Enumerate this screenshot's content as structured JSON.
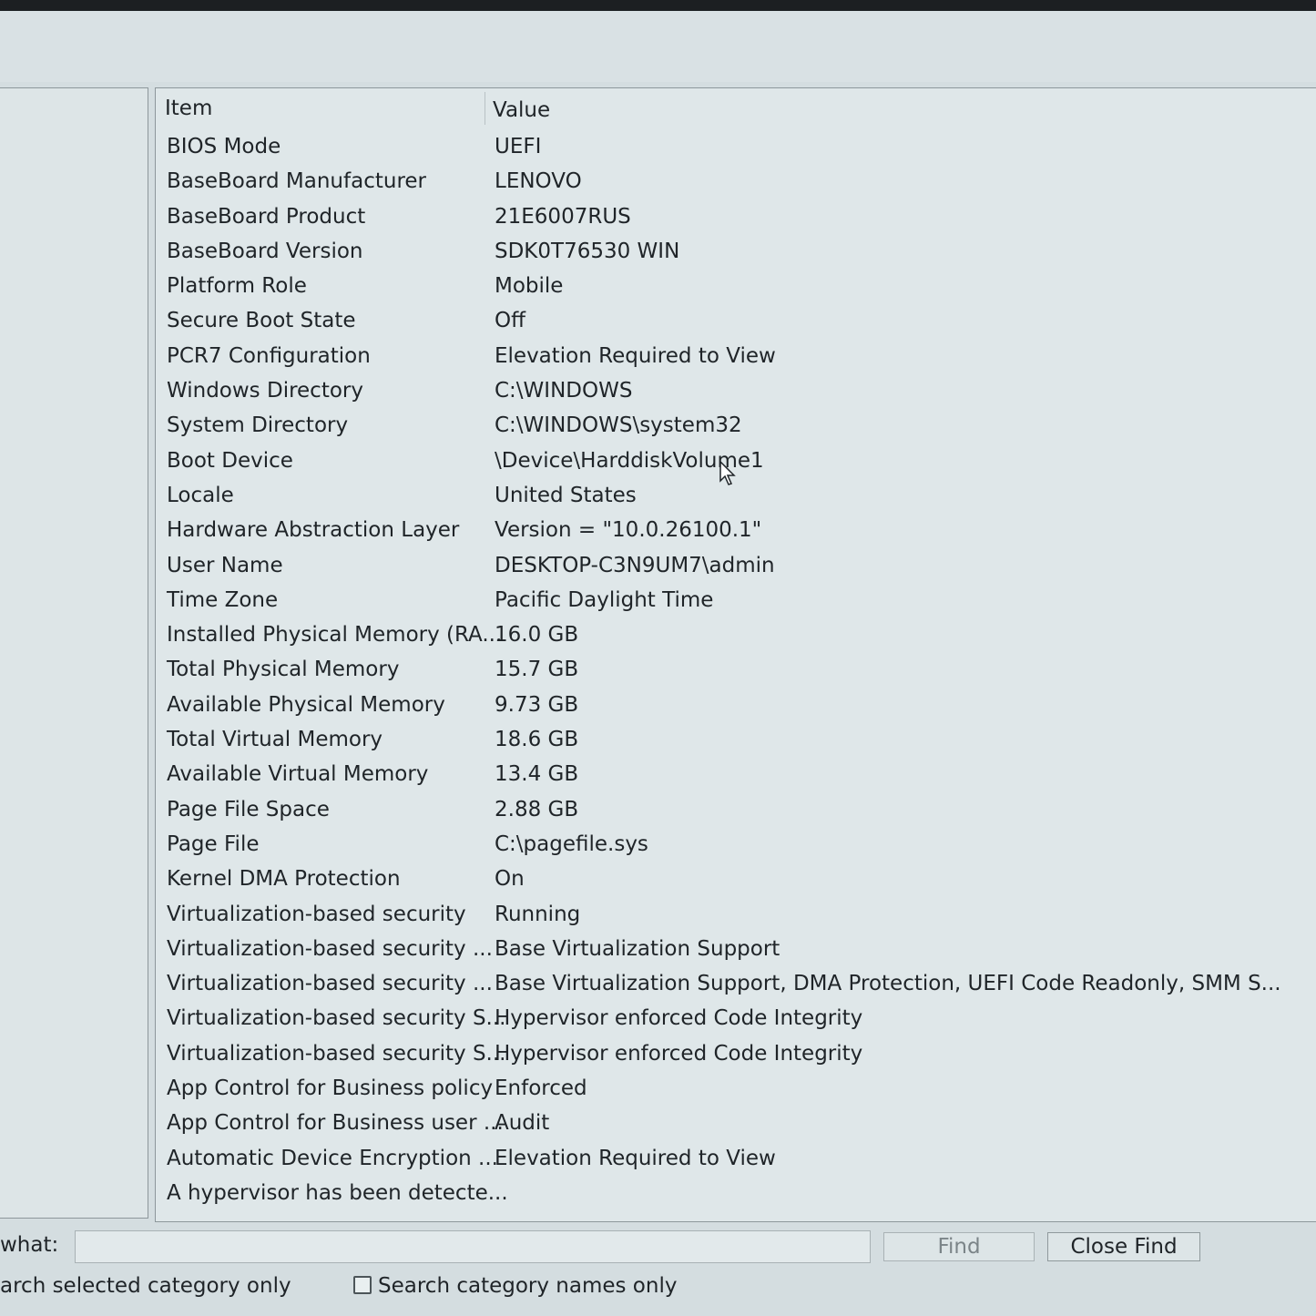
{
  "table": {
    "header": {
      "item": "Item",
      "value": "Value"
    },
    "rows": [
      {
        "item": "BIOS Mode",
        "value": "UEFI"
      },
      {
        "item": "BaseBoard Manufacturer",
        "value": "LENOVO"
      },
      {
        "item": "BaseBoard Product",
        "value": "21E6007RUS"
      },
      {
        "item": "BaseBoard Version",
        "value": "SDK0T76530 WIN"
      },
      {
        "item": "Platform Role",
        "value": "Mobile"
      },
      {
        "item": "Secure Boot State",
        "value": "Off"
      },
      {
        "item": "PCR7 Configuration",
        "value": "Elevation Required to View"
      },
      {
        "item": "Windows Directory",
        "value": "C:\\WINDOWS"
      },
      {
        "item": "System Directory",
        "value": "C:\\WINDOWS\\system32"
      },
      {
        "item": "Boot Device",
        "value": "\\Device\\HarddiskVolume1"
      },
      {
        "item": "Locale",
        "value": "United States"
      },
      {
        "item": "Hardware Abstraction Layer",
        "value": "Version = \"10.0.26100.1\""
      },
      {
        "item": "User Name",
        "value": "DESKTOP-C3N9UM7\\admin"
      },
      {
        "item": "Time Zone",
        "value": "Pacific Daylight Time"
      },
      {
        "item": "Installed Physical Memory (RA...",
        "value": "16.0 GB"
      },
      {
        "item": "Total Physical Memory",
        "value": "15.7 GB"
      },
      {
        "item": "Available Physical Memory",
        "value": "9.73 GB"
      },
      {
        "item": "Total Virtual Memory",
        "value": "18.6 GB"
      },
      {
        "item": "Available Virtual Memory",
        "value": "13.4 GB"
      },
      {
        "item": "Page File Space",
        "value": "2.88 GB"
      },
      {
        "item": "Page File",
        "value": "C:\\pagefile.sys"
      },
      {
        "item": "Kernel DMA Protection",
        "value": "On"
      },
      {
        "item": "Virtualization-based security",
        "value": "Running"
      },
      {
        "item": "Virtualization-based security ...",
        "value": "Base Virtualization Support"
      },
      {
        "item": "Virtualization-based security ...",
        "value": "Base Virtualization Support, DMA Protection, UEFI Code Readonly, SMM S..."
      },
      {
        "item": "Virtualization-based security S...",
        "value": "Hypervisor enforced Code Integrity"
      },
      {
        "item": "Virtualization-based security S...",
        "value": "Hypervisor enforced Code Integrity"
      },
      {
        "item": "App Control for Business policy",
        "value": "Enforced"
      },
      {
        "item": "App Control for Business user ...",
        "value": "Audit"
      },
      {
        "item": "Automatic Device Encryption ...",
        "value": "Elevation Required to View"
      },
      {
        "item": "A hypervisor has been detecte...",
        "value": ""
      }
    ]
  },
  "find_bar": {
    "label": "what:",
    "input_value": "",
    "find_button": "Find",
    "close_find_button": "Close Find",
    "search_selected_label": "arch selected category only",
    "search_names_label": "Search category names only",
    "search_names_checked": false
  },
  "icons": {
    "cursor": "mouse-pointer-icon",
    "checkbox": "checkbox-icon"
  },
  "colors": {
    "background": "#d4dde0",
    "pane": "#dfe7e9",
    "text": "#1f2428",
    "disabled_text": "#7b8488"
  }
}
